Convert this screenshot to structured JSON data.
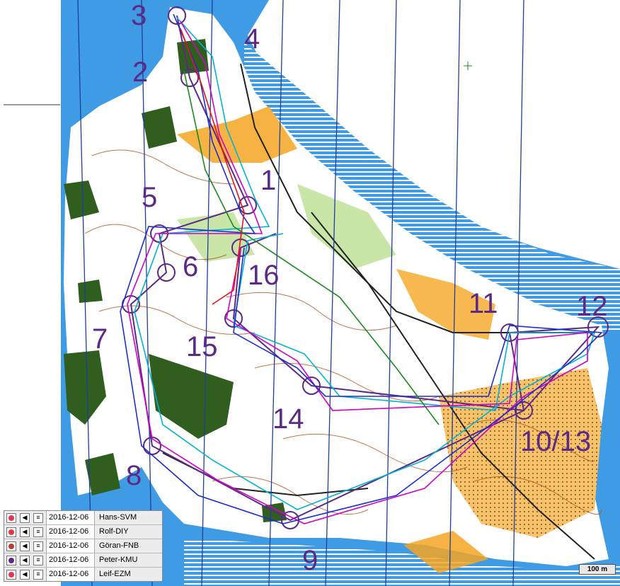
{
  "map": {
    "controls": [
      "1",
      "2",
      "3",
      "4",
      "5",
      "6",
      "7",
      "8",
      "9",
      "10/13",
      "11",
      "12",
      "14",
      "15",
      "16"
    ],
    "colors": {
      "water": "#3f9be4",
      "forest_open": "#ffffff",
      "open_yellow": "#f5a623",
      "vegetation_green": "#2f5e1e",
      "contour_brown": "#b4501e",
      "course_purple": "#5b2a86"
    }
  },
  "legend": {
    "rows": [
      {
        "color": "#e8334a",
        "date": "2016-12-06",
        "name": "Hans-SVM"
      },
      {
        "color": "#e8334a",
        "date": "2016-12-06",
        "name": "Rolf-DIY"
      },
      {
        "color": "#b6402a",
        "date": "2016-12-06",
        "name": "Göran-FNB"
      },
      {
        "color": "#5b2a86",
        "date": "2016-12-06",
        "name": "Peter-KMU"
      },
      {
        "color": "#e8334a",
        "date": "2016-12-06",
        "name": "Leif-EZM"
      }
    ]
  },
  "scale": {
    "label": "100 m"
  }
}
